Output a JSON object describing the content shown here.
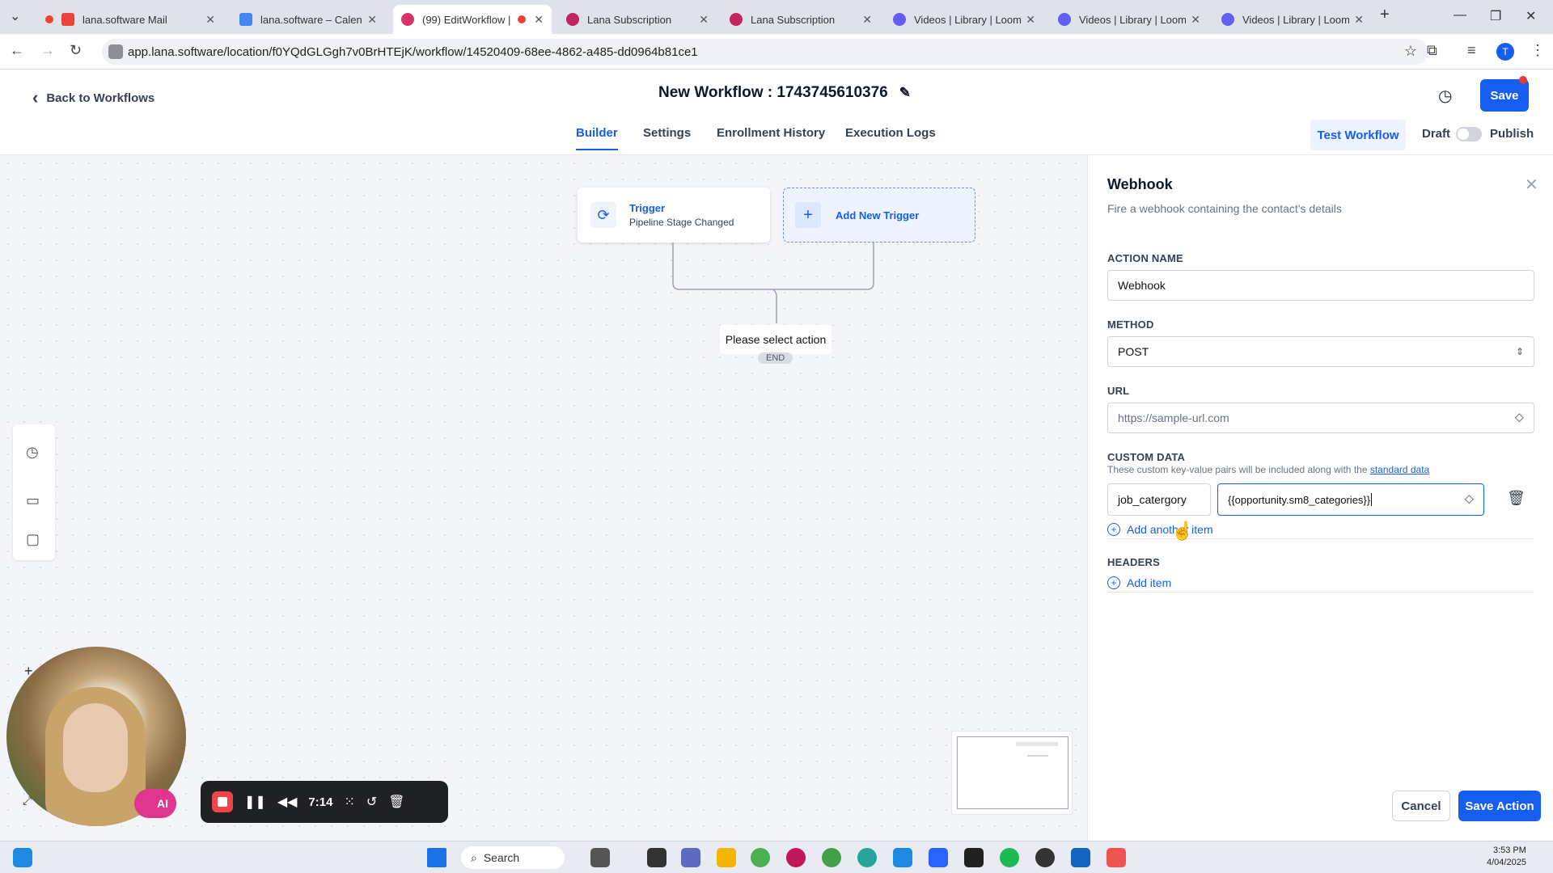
{
  "browser": {
    "tabs": [
      {
        "title": "lana.software Mail",
        "favicon_color": "#ea4335"
      },
      {
        "title": "lana.software – Calendar",
        "favicon_color": "#4285f4"
      },
      {
        "title": "(99) EditWorkflow |",
        "favicon_color": "#d6336c"
      },
      {
        "title": "Lana Subscription",
        "favicon_color": "#c2255c"
      },
      {
        "title": "Lana Subscription",
        "favicon_color": "#c2255c"
      },
      {
        "title": "Videos | Library | Loom",
        "favicon_color": "#625df5"
      },
      {
        "title": "Videos | Library | Loom",
        "favicon_color": "#625df5"
      },
      {
        "title": "Videos | Library | Loom",
        "favicon_color": "#625df5"
      }
    ],
    "url": "app.lana.software/location/f0YQdGLGgh7v0BrHTEjK/workflow/14520409-68ee-4862-a485-dd0964b81ce1",
    "profile_initial": "T"
  },
  "header": {
    "back_label": "Back to Workflows",
    "title": "New Workflow : 1743745610376",
    "save_label": "Save"
  },
  "subnav": {
    "tabs": [
      "Builder",
      "Settings",
      "Enrollment History",
      "Execution Logs"
    ],
    "active": "Builder",
    "test_workflow": "Test Workflow",
    "draft": "Draft",
    "publish": "Publish"
  },
  "canvas": {
    "trigger_label": "Trigger",
    "trigger_sub": "Pipeline Stage Changed",
    "add_trigger": "Add New Trigger",
    "select_action": "Please select action",
    "end_label": "END"
  },
  "panel": {
    "title": "Webhook",
    "description": "Fire a webhook containing the contact's details",
    "action_name_label": "ACTION NAME",
    "action_name_value": "Webhook",
    "method_label": "METHOD",
    "method_value": "POST",
    "url_label": "URL",
    "url_placeholder": "https://sample-url.com",
    "custom_data_label": "CUSTOM DATA",
    "custom_data_help": "These custom key-value pairs will be included along with the",
    "custom_data_link": "standard data",
    "custom_key": "job_catergory",
    "custom_value": "{{opportunity.sm8_categories}}",
    "add_another": "Add another item",
    "headers_label": "HEADERS",
    "add_item": "Add item",
    "cancel": "Cancel",
    "save_action": "Save Action"
  },
  "recorder": {
    "time": "7:14",
    "ai_label": "AI"
  },
  "taskbar": {
    "search": "Search",
    "time": "3:53 PM",
    "date": "4/04/2025"
  }
}
